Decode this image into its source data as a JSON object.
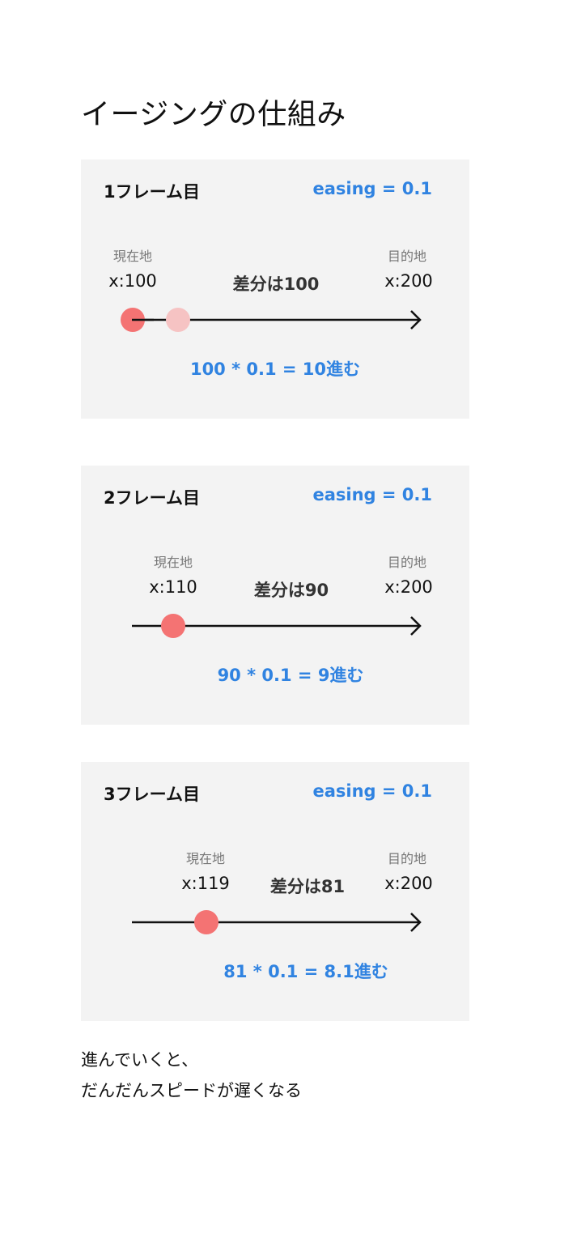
{
  "title": "イージングの仕組み",
  "easing_label": "easing = 0.1",
  "current_caption": "現在地",
  "target_caption": "目的地",
  "frames": [
    {
      "label": "1フレーム目",
      "current": "x:100",
      "target": "x:200",
      "diff": "差分は100",
      "calc": "100 * 0.1 = 10進む"
    },
    {
      "label": "2フレーム目",
      "current": "x:110",
      "target": "x:200",
      "diff": "差分は90",
      "calc": "90 * 0.1 = 9進む"
    },
    {
      "label": "3フレーム目",
      "current": "x:119",
      "target": "x:200",
      "diff": "差分は81",
      "calc": "81 * 0.1 = 8.1進む"
    }
  ],
  "footer": {
    "line1": "進んでいくと、",
    "line2": "だんだんスピードが遅くなる"
  },
  "colors": {
    "accent": "#3083e1",
    "dot": "#f47373",
    "ghost_dot": "#f6c3c3",
    "card_bg": "#f3f3f3"
  }
}
